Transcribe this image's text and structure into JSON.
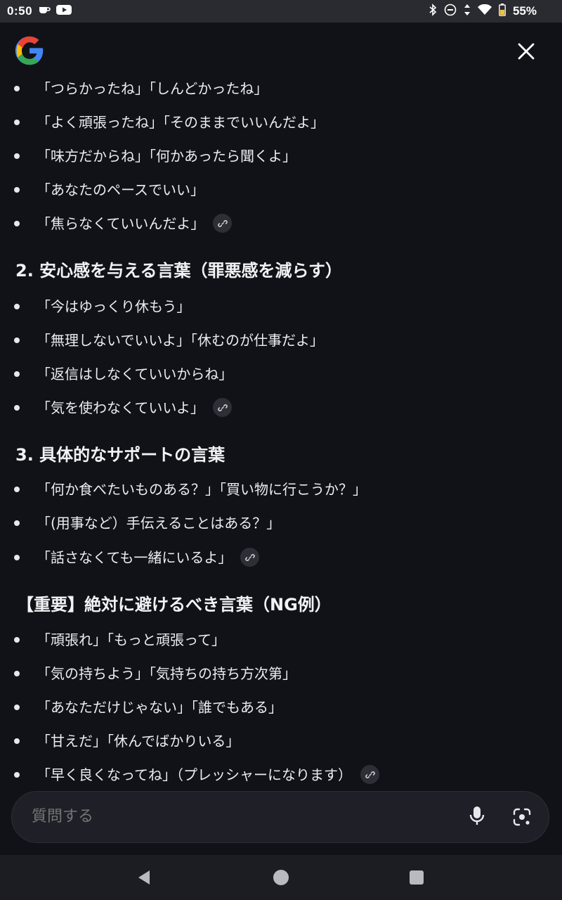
{
  "status_bar": {
    "time": "0:50",
    "battery": "55%",
    "icons": [
      "coffee-icon",
      "youtube-icon",
      "bluetooth-icon",
      "dnd-icon",
      "data-arrows-icon",
      "wifi-icon",
      "battery-icon"
    ]
  },
  "header": {
    "logo": "google-g-logo",
    "close_icon": "close-icon"
  },
  "list1": {
    "items": [
      "「つらかったね」「しんどかったね」",
      "「よく頑張ったね」「そのままでいいんだよ」",
      "「味方だからね」「何かあったら聞くよ」",
      "「あなたのペースでいい」",
      "「焦らなくていいんだよ」"
    ]
  },
  "section2": {
    "heading": "2. 安心感を与える言葉（罪悪感を減らす）",
    "items": [
      "「今はゆっくり休もう」",
      "「無理しないでいいよ」「休むのが仕事だよ」",
      "「返信はしなくていいからね」",
      "「気を使わなくていいよ」"
    ]
  },
  "section3": {
    "heading": "3. 具体的なサポートの言葉",
    "items": [
      "「何か食べたいものある？」「買い物に行こうか？」",
      "「(用事など）手伝えることはある？」",
      "「話さなくても一緒にいるよ」"
    ]
  },
  "section4": {
    "heading": "【重要】絶対に避けるべき言葉（NG例）",
    "items": [
      "「頑張れ」「もっと頑張って」",
      "「気の持ちよう」「気持ちの持ち方次第」",
      "「あなただけじゃない」「誰でもある」",
      "「甘えだ」「休んでばかりいる」",
      "「早く良くなってね」（プレッシャーになります）"
    ]
  },
  "ask_bar": {
    "placeholder": "質問する",
    "mic_icon": "mic-icon",
    "lens_icon": "lens-camera-icon"
  },
  "nav": {
    "back": "back-icon",
    "home": "home-icon",
    "recents": "recents-icon"
  },
  "colors": {
    "background": "#111218",
    "status_bar": "#2a2b30",
    "text": "#ecedf0",
    "chip": "#2e2f36"
  }
}
